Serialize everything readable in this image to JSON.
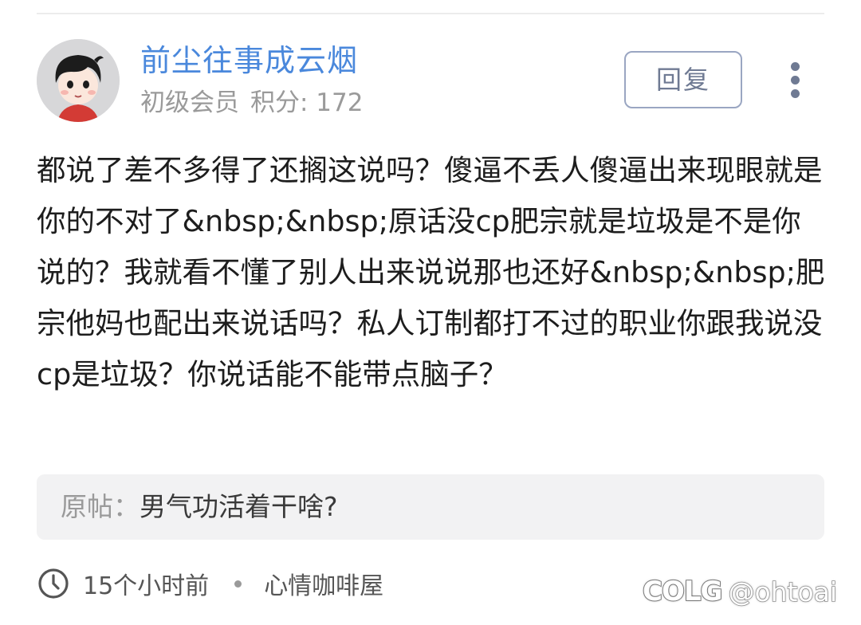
{
  "post": {
    "author": {
      "name": "前尘往事成云烟",
      "level": "初级会员",
      "points_label": "积分: 172"
    },
    "reply_label": "回复",
    "content": "都说了差不多得了还搁这说吗？傻逼不丢人傻逼出来现眼就是你的不对了&nbsp;&nbsp;原话没cp肥宗就是垃圾是不是你说的？我就看不懂了别人出来说说那也还好&nbsp;&nbsp;肥宗他妈也配出来说话吗？私人订制都打不过的职业你跟我说没cp是垃圾？你说话能不能带点脑子？",
    "quote": {
      "label": "原帖：",
      "title": "男气功活着干啥?"
    },
    "footer": {
      "time": "15个小时前",
      "board": "心情咖啡屋"
    }
  },
  "watermark": {
    "logo": "COLG",
    "handle": "@ohtoai"
  },
  "colors": {
    "username": "#4a88dc",
    "secondary_text": "#9a9a9a",
    "button_border": "#9aa6c2",
    "quote_bg": "#f2f2f3"
  },
  "icons": [
    "more-vertical-icon",
    "clock-icon",
    "avatar-cartoon"
  ]
}
